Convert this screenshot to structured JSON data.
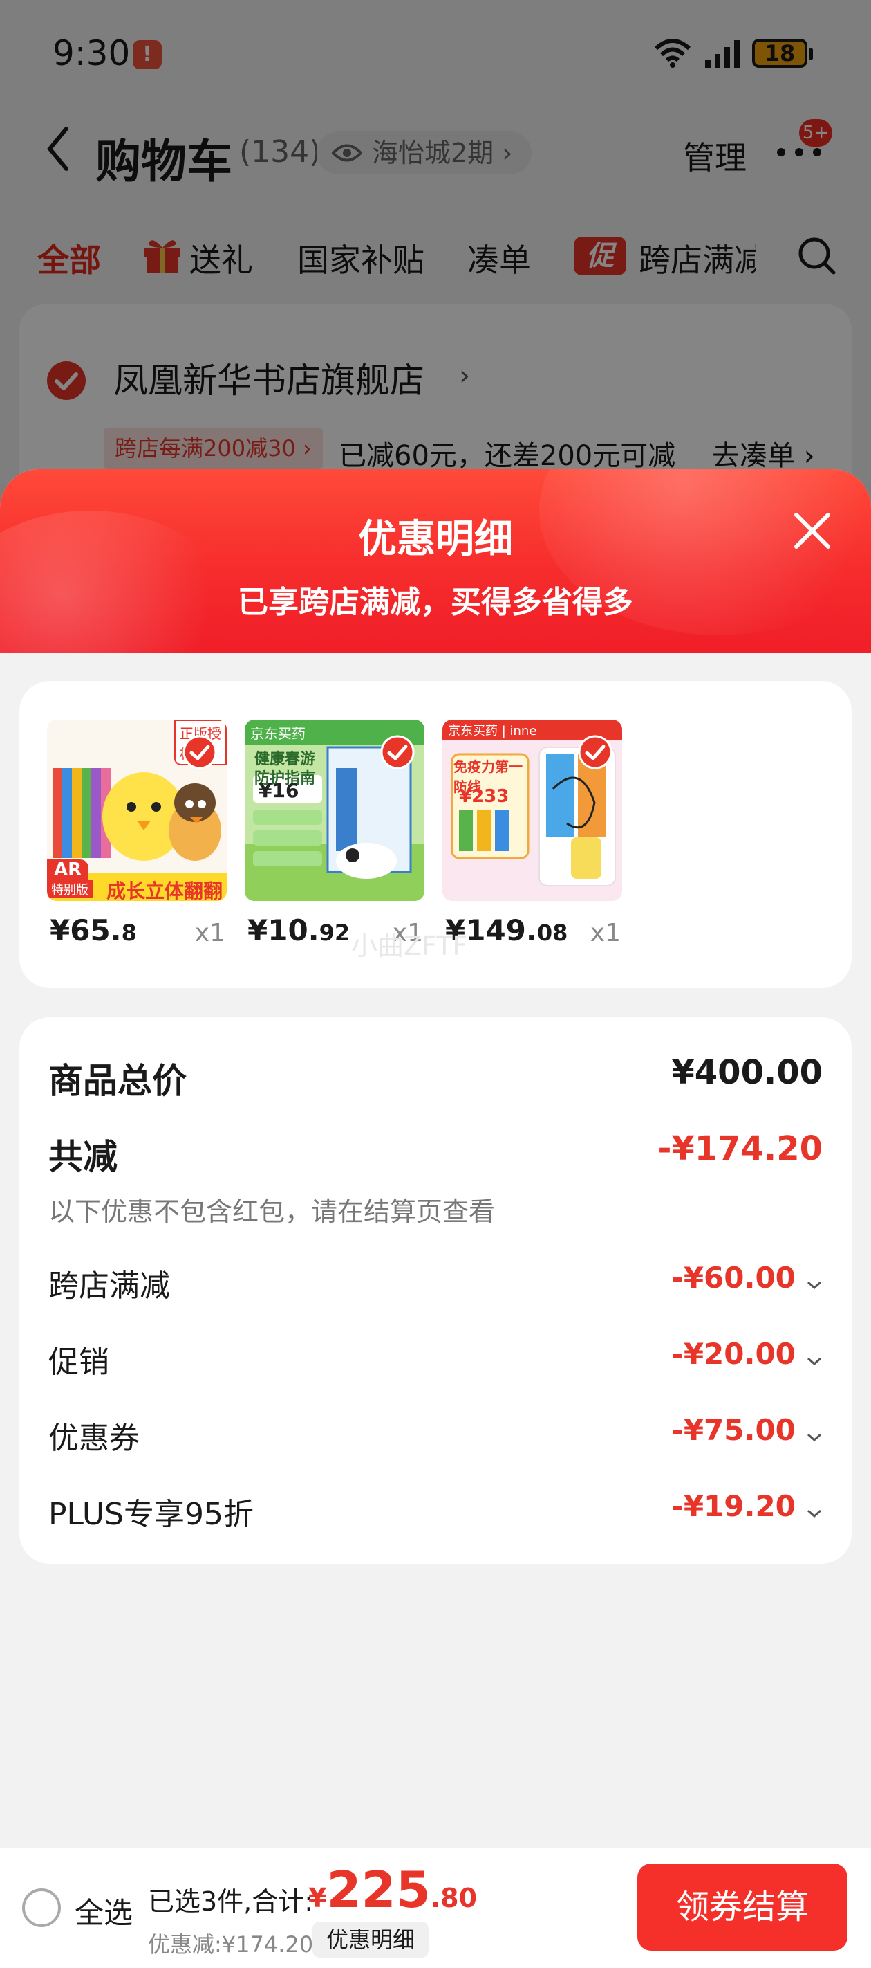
{
  "status_bar": {
    "time": "9:30",
    "alert": "!",
    "battery": "18"
  },
  "nav": {
    "title": "购物车",
    "count": "(134)",
    "location": "海怡城2期",
    "location_arrow": "›",
    "manage": "管理",
    "more_badge": "5+"
  },
  "tabs": [
    {
      "label": "全部"
    },
    {
      "label": "送礼"
    },
    {
      "label": "国家补贴"
    },
    {
      "label": "凑单"
    },
    {
      "label": "跨店满减"
    }
  ],
  "promo_icon_text": "促",
  "store": {
    "name": "凤凰新华书店旗舰店",
    "arrow": "›",
    "promo_tag": "跨店每满200减30 ›",
    "promo_desc": "已减60元，还差200元可减",
    "go": "去凑单 ›"
  },
  "sheet": {
    "title": "优惠明细",
    "subtitle": "已享跨店满减，买得多省得多",
    "watermark": "小曲ZFTF"
  },
  "products": [
    {
      "price_int": "¥65.",
      "price_dec": "8",
      "qty": "x1",
      "badge": "正版授权",
      "ar": "AR",
      "ar2": "特别版",
      "caption": "成长立体翻翻书"
    },
    {
      "price_int": "¥10.",
      "price_dec": "92",
      "qty": "x1",
      "brand": "京东买药",
      "caption": "健康春游 防护指南",
      "price_tag": "¥16"
    },
    {
      "price_int": "¥149.",
      "price_dec": "08",
      "qty": "x1",
      "brand": "京东买药 | inne",
      "caption": "免疫力第一防线",
      "price_tag": "¥233"
    }
  ],
  "summary": {
    "total_label": "商品总价",
    "total_value": "¥400.00",
    "reduce_label": "共减",
    "reduce_value": "-¥174.20",
    "note": "以下优惠不包含红包，请在结算页查看",
    "items": [
      {
        "label": "跨店满减",
        "value": "-¥60.00"
      },
      {
        "label": "促销",
        "value": "-¥20.00"
      },
      {
        "label": "优惠券",
        "value": "-¥75.00"
      },
      {
        "label": "PLUS专享95折",
        "value": "-¥19.20"
      }
    ]
  },
  "bottom": {
    "select_all": "全选",
    "selected": "已选3件,合计:",
    "currency": "¥",
    "total_int": "225",
    "total_dec": ".80",
    "saved": "优惠减:¥174.20",
    "detail": "优惠明细",
    "checkout": "领券结算"
  },
  "colors": {
    "accent_red": "#e8352a",
    "header_red": "#f62c2c",
    "checkout_red": "#f5302a"
  }
}
